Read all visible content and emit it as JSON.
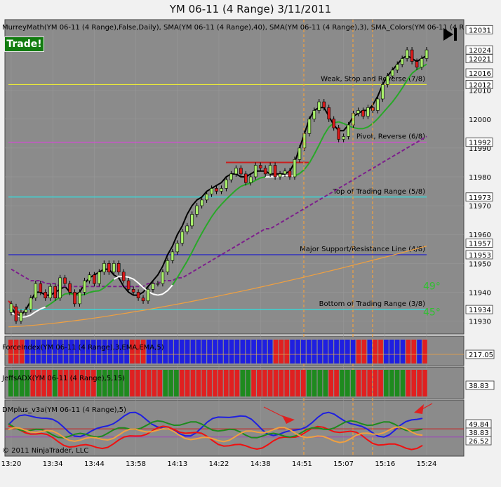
{
  "header": {
    "title": "YM 06-11 (4 Range)  3/11/2011",
    "trade_label": "Trade!"
  },
  "colors": {
    "background": "#8b8b8b",
    "up_candle": "#a8f06a",
    "down_candle": "#d81a1a",
    "sma40": "#7d1f8c",
    "sma3": "#000000",
    "sma_colors": "#28a828",
    "long_ma": "#f0a040",
    "weak_stop": "#e8e83a",
    "pivot": "#e040e0",
    "top_range": "#30e0e0",
    "major_support": "#2020c8",
    "bottom_range": "#30e0e0",
    "force_up": "#1f1fe0",
    "force_down": "#e02020",
    "adx_green": "#1e8a1e",
    "adx_red": "#e02020",
    "dmplus_blue": "#1f1fe0",
    "dmplus_red": "#f01010",
    "dmplus_green": "#1e8a1e",
    "dmplus_orange": "#f0a040"
  },
  "price_panel": {
    "legend": "MurreyMath(YM 06-11 (4 Range),False,Daily), SMA(YM 06-11 (4 Range),40), SMA(YM 06-11 (4 Range),3), SMA_Colors(YM 06-11 (4 R",
    "y_ticks": [
      11930,
      11940,
      11950,
      11960,
      11970,
      11980,
      11990,
      12000,
      12010
    ],
    "boxed_ticks": [
      12031,
      12024,
      12021,
      12016,
      12012,
      11992,
      11973,
      11957,
      11953,
      11934
    ],
    "levels": [
      {
        "label": "Weak, Stop and Reverse (7/8)",
        "value": 12012,
        "color": "#e8e83a"
      },
      {
        "label": "Pivot, Reverse (6/8)",
        "value": 11992,
        "color": "#e040e0"
      },
      {
        "label": "Top of Trading Range (5/8)",
        "value": 11973,
        "color": "#30e0e0"
      },
      {
        "label": "Major Support/Resistance Line (4/8)",
        "value": 11953,
        "color": "#2020c8"
      },
      {
        "label": "Bottom of Trading Range (3/8)",
        "value": 11934,
        "color": "#30e0e0"
      }
    ],
    "angle_labels": [
      "49°",
      "45°"
    ]
  },
  "chart_data": {
    "type": "candlestick",
    "y_range": [
      11926,
      12034
    ],
    "candles": [
      [
        11933,
        11936
      ],
      [
        11935,
        11930
      ],
      [
        11930,
        11933
      ],
      [
        11933,
        11934
      ],
      [
        11934,
        11938
      ],
      [
        11938,
        11943
      ],
      [
        11943,
        11940
      ],
      [
        11940,
        11938
      ],
      [
        11938,
        11942
      ],
      [
        11942,
        11938
      ],
      [
        11938,
        11945
      ],
      [
        11945,
        11943
      ],
      [
        11943,
        11940
      ],
      [
        11940,
        11936
      ],
      [
        11936,
        11940
      ],
      [
        11940,
        11944
      ],
      [
        11944,
        11946
      ],
      [
        11946,
        11943
      ],
      [
        11943,
        11947
      ],
      [
        11947,
        11950
      ],
      [
        11950,
        11947
      ],
      [
        11947,
        11950
      ],
      [
        11950,
        11947
      ],
      [
        11947,
        11944
      ],
      [
        11944,
        11941
      ],
      [
        11941,
        11940
      ],
      [
        11940,
        11938
      ],
      [
        11938,
        11937
      ],
      [
        11937,
        11941
      ],
      [
        11941,
        11943
      ],
      [
        11943,
        11943
      ],
      [
        11943,
        11947
      ],
      [
        11947,
        11951
      ],
      [
        11951,
        11954
      ],
      [
        11954,
        11957
      ],
      [
        11957,
        11961
      ],
      [
        11961,
        11963
      ],
      [
        11963,
        11967
      ],
      [
        11967,
        11970
      ],
      [
        11970,
        11972
      ],
      [
        11972,
        11974
      ],
      [
        11974,
        11976
      ],
      [
        11976,
        11975
      ],
      [
        11975,
        11976
      ],
      [
        11976,
        11979
      ],
      [
        11979,
        11981
      ],
      [
        11981,
        11983
      ],
      [
        11983,
        11981
      ],
      [
        11981,
        11978
      ],
      [
        11978,
        11980
      ],
      [
        11980,
        11984
      ],
      [
        11984,
        11983
      ],
      [
        11983,
        11981
      ],
      [
        11981,
        11984
      ],
      [
        11984,
        11980
      ],
      [
        11980,
        11981
      ],
      [
        11981,
        11982
      ],
      [
        11982,
        11980
      ],
      [
        11980,
        11986
      ],
      [
        11986,
        11990
      ],
      [
        11990,
        11995
      ],
      [
        11995,
        12000
      ],
      [
        12000,
        12003
      ],
      [
        12003,
        12006
      ],
      [
        12006,
        12004
      ],
      [
        12004,
        12000
      ],
      [
        12000,
        11997
      ],
      [
        11997,
        11993
      ],
      [
        11993,
        11994
      ],
      [
        11994,
        11998
      ],
      [
        11998,
        12002
      ],
      [
        12002,
        12003
      ],
      [
        12003,
        12001
      ],
      [
        12001,
        12004
      ],
      [
        12004,
        12003
      ],
      [
        12003,
        12007
      ],
      [
        12007,
        12012
      ],
      [
        12012,
        12015
      ],
      [
        12015,
        12017
      ],
      [
        12017,
        12019
      ],
      [
        12019,
        12021
      ],
      [
        12021,
        12024
      ],
      [
        12024,
        12020
      ],
      [
        12020,
        12018
      ],
      [
        12018,
        12021
      ],
      [
        12021,
        12024
      ]
    ],
    "series": [
      {
        "name": "SMA(YM 06-11 (4 Range),3)",
        "color": "#000000",
        "values": [
          11935,
          11932,
          11932,
          11934,
          11937,
          11940,
          11940,
          11939,
          11939,
          11940,
          11941,
          11942,
          11940,
          11939,
          11940,
          11943,
          11945,
          11946,
          11947,
          11948,
          11948,
          11946,
          11945,
          11942,
          11940,
          11939,
          11939,
          11940,
          11942,
          11944,
          11946,
          11949,
          11953,
          11956,
          11960,
          11963,
          11967,
          11970,
          11972,
          11973,
          11975,
          11976,
          11977,
          11978,
          11980,
          11981,
          11981,
          11980,
          11980,
          11981,
          11982,
          11982,
          11982,
          11981,
          11981,
          11981,
          11981,
          11982,
          11985,
          11990,
          11995,
          12000,
          12003,
          12004,
          12004,
          12001,
          11998,
          11996,
          11996,
          11998,
          12001,
          12002,
          12003,
          12003,
          12005,
          12008,
          12012,
          12015,
          12017,
          12019,
          12021,
          12022,
          12021,
          12020,
          12021,
          12022
        ]
      },
      {
        "name": "SMA(YM 06-11 (4 Range),40)",
        "color": "#7d1f8c",
        "values": [
          11948,
          11947,
          11946,
          11945,
          11944,
          11944,
          11944,
          11943,
          11943,
          11943,
          11942,
          11942,
          11942,
          11942,
          11942,
          11942,
          11942,
          11942,
          11942,
          11942,
          11942,
          11942,
          11942,
          11942,
          11942,
          11942,
          11942,
          11942,
          11943,
          11943,
          11943,
          11944,
          11944,
          11944,
          11945,
          11945,
          11946,
          11947,
          11948,
          11949,
          11950,
          11951,
          11952,
          11953,
          11954,
          11955,
          11956,
          11957,
          11958,
          11959,
          11960,
          11961,
          11962,
          11962,
          11963,
          11964,
          11965,
          11966,
          11967,
          11968,
          11969,
          11970,
          11971,
          11972,
          11973,
          11974,
          11975,
          11976,
          11977,
          11978,
          11979,
          11980,
          11981,
          11982,
          11983,
          11984,
          11985,
          11986,
          11987,
          11988,
          11989,
          11990,
          11991,
          11992,
          11993,
          11994
        ]
      }
    ],
    "x_ticks": [
      "13:20",
      "13:34",
      "13:44",
      "13:58",
      "14:13",
      "14:22",
      "14:38",
      "14:51",
      "15:07",
      "15:16",
      "15:24"
    ]
  },
  "indicators": {
    "force_index": {
      "legend": "ForceIndex(YM 06-11 (4 Range),3,EMA,EMA,5)",
      "value_label": "217.05"
    },
    "jeffs_adx": {
      "legend": "JeffsADX(YM 06-11 (4 Range),5,15)",
      "value_label": "38.83"
    },
    "dmplus": {
      "legend": "DMplus_v3a(YM 06-11 (4 Range),5)",
      "value_labels": [
        "49.84",
        "38.83",
        "26.52"
      ]
    }
  },
  "footer": {
    "copyright": "© 2011 NinjaTrader, LLC"
  }
}
